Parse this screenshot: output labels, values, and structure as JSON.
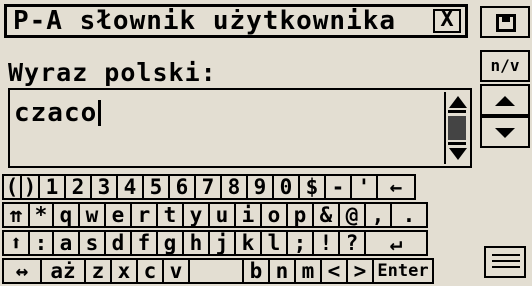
{
  "window": {
    "title": "P-A słownik użytkownika",
    "close_label": "X"
  },
  "form": {
    "label": "Wyraz polski:",
    "input_value": "czaco"
  },
  "side": {
    "nv_label": "n/v"
  },
  "keyboard": {
    "row1": [
      "(",
      ")",
      "1",
      "2",
      "3",
      "4",
      "5",
      "6",
      "7",
      "8",
      "9",
      "0",
      "$",
      "-",
      "'",
      "←"
    ],
    "row2": [
      "⇈",
      "*",
      "q",
      "w",
      "e",
      "r",
      "t",
      "y",
      "u",
      "i",
      "o",
      "p",
      "&",
      "@",
      ",",
      "."
    ],
    "row3": [
      "⬆",
      ":",
      "a",
      "s",
      "d",
      "f",
      "g",
      "h",
      "j",
      "k",
      "l",
      ";",
      "!",
      "?",
      "↵"
    ],
    "row4": [
      "↔",
      "aż",
      "z",
      "x",
      "c",
      "v",
      "",
      "b",
      "n",
      "m",
      "<",
      ">",
      "Enter"
    ]
  }
}
